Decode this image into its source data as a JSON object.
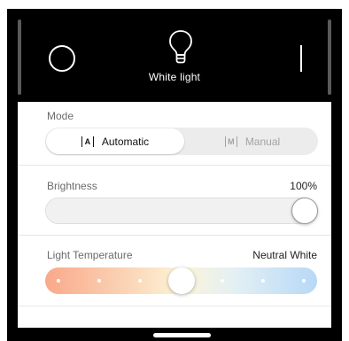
{
  "header": {
    "title": "White light",
    "power_icon": "power-ring-icon",
    "bulb_icon": "lightbulb-icon"
  },
  "mode": {
    "label": "Mode",
    "options": [
      {
        "label": "Automatic",
        "icon": "auto-mode-icon",
        "glyph": "A",
        "selected": true
      },
      {
        "label": "Manual",
        "icon": "manual-mode-icon",
        "glyph": "M",
        "selected": false
      }
    ]
  },
  "brightness": {
    "label": "Brightness",
    "value_text": "100%",
    "level_percent": 100
  },
  "temperature": {
    "label": "Light Temperature",
    "value_text": "Neutral White",
    "stops": 7,
    "selected_stop": 3,
    "gradient_colors": [
      "#f9a98a",
      "#fbd7b9",
      "#fdf4d8",
      "#e2f0f4",
      "#b7d8f6"
    ]
  },
  "colors": {
    "header_bg": "#000000",
    "toggle_bg": "#ececec",
    "label": "#6b6b6b"
  }
}
